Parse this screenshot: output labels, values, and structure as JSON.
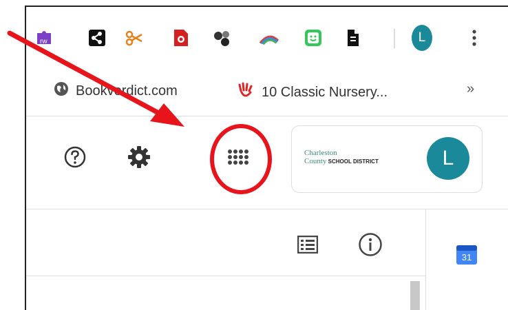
{
  "extensions": {
    "rw_label": "rw",
    "profile_initial": "L"
  },
  "bookmarks": {
    "items": [
      {
        "label": "Bookverdict.com"
      },
      {
        "label": "10 Classic Nursery..."
      }
    ],
    "overflow": "»"
  },
  "header": {
    "account_logo_text_1": "Charleston",
    "account_logo_text_2": "County",
    "account_logo_text_3": "SCHOOL DISTRICT",
    "account_initial": "L"
  },
  "toolbar": {
    "calendar_day": "31"
  },
  "colors": {
    "annotation": "#e8141c",
    "avatar": "#1a8a9a",
    "calendar": "#4285f4"
  }
}
